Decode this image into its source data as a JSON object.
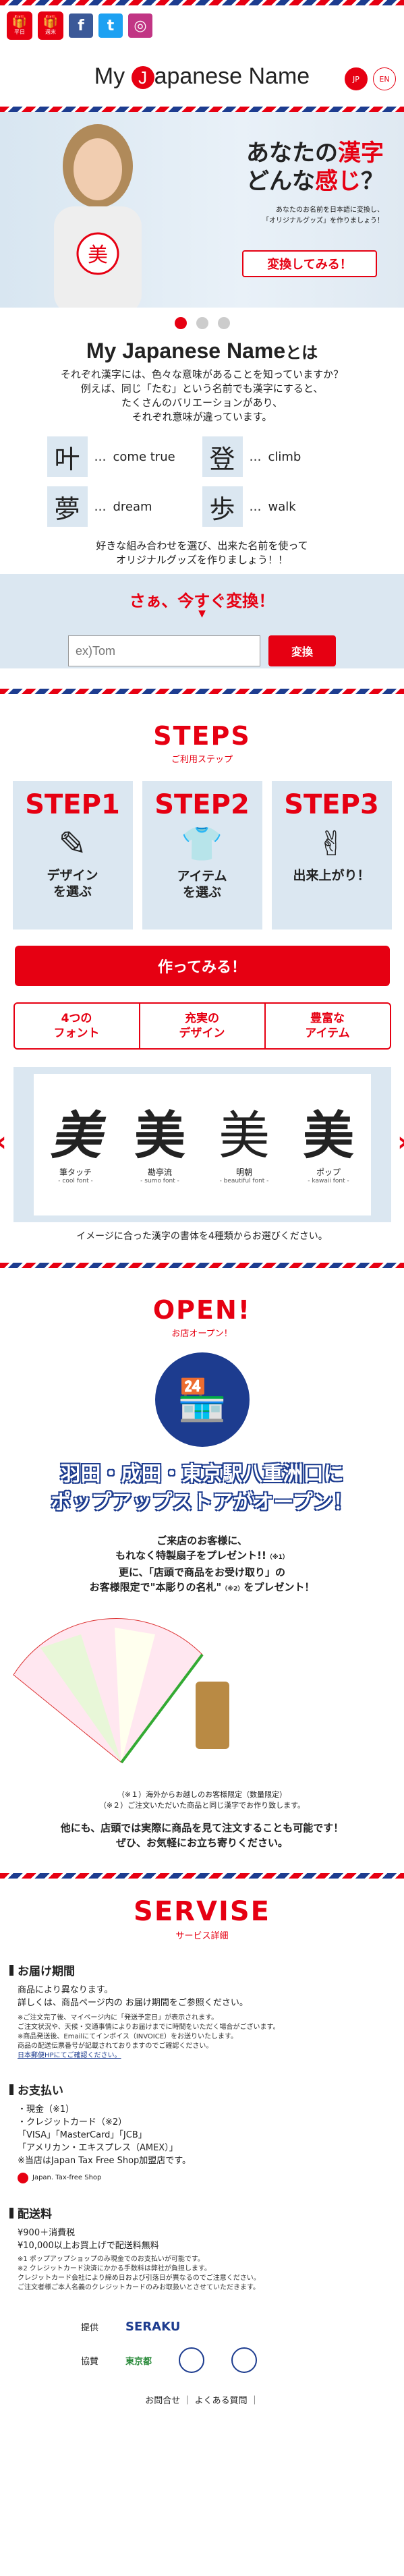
{
  "topbar": {
    "gift1": "平日",
    "gift2": "週末",
    "fb": "f",
    "tw": "t",
    "ig": "◎"
  },
  "logo": {
    "part1": "My",
    "dot": "J",
    "part2": "apanese Name"
  },
  "lang": {
    "jp": "JP",
    "en": "EN"
  },
  "hero": {
    "title1": "あなたの",
    "title_kanji": "漢字",
    "title2": "どんな",
    "title_kan": "感じ",
    "title3": "？",
    "sub1": "あなたのお名前を日本語に変換し、",
    "sub2": "「オリジナルグッズ」を作りましょう！",
    "button": "変換してみる！",
    "shirt": "美"
  },
  "intro": {
    "title": "My Japanese Name",
    "title_suffix": "とは",
    "lines": [
      "それぞれ漢字には、色々な意味があることを知っていますか？",
      "例えば、同じ「たむ」という名前でも漢字にすると、",
      "たくさんのバリエーションがあり、",
      "それぞれ意味が違っています。"
    ],
    "kanji": [
      {
        "k": "叶",
        "w": "come true"
      },
      {
        "k": "登",
        "w": "climb"
      },
      {
        "k": "夢",
        "w": "dream"
      },
      {
        "k": "歩",
        "w": "walk"
      }
    ],
    "dots": "…",
    "outro1": "好きな組み合わせを選び、出来た名前を使って",
    "outro2": "オリジナルグッズを作りましょう！！"
  },
  "convert": {
    "title": "さぁ、今すぐ変換！",
    "arrow": "▼",
    "placeholder": "ex)Tom",
    "button": "変換"
  },
  "steps": {
    "title": "STEPS",
    "sub": "ご利用ステップ",
    "items": [
      {
        "n": "STEP1",
        "l": "デザイン\nを選ぶ",
        "ic": "✎"
      },
      {
        "n": "STEP2",
        "l": "アイテム\nを選ぶ",
        "ic": "👕"
      },
      {
        "n": "STEP3",
        "l": "出来上がり！",
        "ic": "✌"
      }
    ],
    "cta": "作ってみる！"
  },
  "tabs": [
    {
      "l": "4つの\nフォント"
    },
    {
      "l": "充実の\nデザイン"
    },
    {
      "l": "豊富な\nアイテム"
    }
  ],
  "fonts": {
    "items": [
      {
        "k": "美",
        "a": "筆タッチ",
        "b": "- cool font -"
      },
      {
        "k": "美",
        "a": "勘亭流",
        "b": "- sumo font -"
      },
      {
        "k": "美",
        "a": "明朝",
        "b": "- beautiful font -"
      },
      {
        "k": "美",
        "a": "ポップ",
        "b": "- kawaii font -"
      }
    ],
    "caption": "イメージに合った漢字の書体を4種類からお選びください。",
    "left": "‹",
    "right": "›"
  },
  "open": {
    "title": "OPEN!",
    "sub": "お店オープン！",
    "head1": "羽田・成田・東京駅八重洲口に",
    "head2": "ポップアップストアがオープン！",
    "p1": "ご来店のお客様に、",
    "p2": "もれなく特製扇子をプレゼント!!",
    "p2n": "（※1）",
    "p3": "更に、「店頭で商品をお受け取り」の",
    "p4": "お客様限定で\"本彫りの名札\"",
    "p4n": "（※2）",
    "p4b": "をプレゼント！",
    "n1": "（※１）海外からお越しのお客様限定（数量限定）",
    "n2": "（※２）ご注文いただいた商品と同じ漢字でお作り致します。",
    "p5": "他にも、店頭では実際に商品を見て注文することも可能です！",
    "p6": "ぜひ、お気軽にお立ち寄りください。"
  },
  "servise": {
    "title": "SERVISE",
    "sub": "サービス詳細",
    "deliv_h": "お届け期間",
    "deliv_1": "商品により異なります。",
    "deliv_2": "詳しくは、商品ページ内の お届け期間をご参照ください。",
    "deliv_notes": [
      "※ご注文完了後、マイページ内に「発送予定日」が表示されます。",
      "ご注文状況や、天候・交通事情によりお届けまでに時間をいただく場合がございます。",
      "※商品発送後、Emailにてインボイス（INVOICE）をお送りいたします。",
      "商品の配送伝票番号が記載されておりますのでご確認ください。",
      "日本郵便HPにてご確認ください。"
    ],
    "pay_h": "お支払い",
    "pay": [
      "・現金（※1）",
      "・クレジットカード（※2）",
      "「VISA」「MasterCard」「JCB」",
      "「アメリカン・エキスプレス（AMEX）」",
      "※当店はJapan Tax Free Shop加盟店です。"
    ],
    "tax": "Japan. Tax-free Shop",
    "ship_h": "配送料",
    "ship": [
      "¥900＋消費税",
      "¥10,000以上お買上げで配送料無料"
    ],
    "ship_notes": [
      "※1 ポップアップショップのみ現金でのお支払いが可能です。",
      "※2 クレジットカード決済にかかる手数料は弊社が負担します。",
      "クレジットカード会社により締め日および引落日が異なるのでご注意ください。",
      "ご注文者様ご本人名義のクレジットカードのみお取扱いとさせていただきます。"
    ]
  },
  "sponsors": {
    "provided": "提供",
    "coop": "協賛",
    "seraku": "SERAKU",
    "tokyo": "東京都"
  },
  "footer": {
    "contact": "お問合せ",
    "faq": "よくある質問",
    "sep": "｜"
  },
  "colors": {
    "accent": "#e60012",
    "navy": "#1d3c8f",
    "panel": "#dbe7f1"
  }
}
